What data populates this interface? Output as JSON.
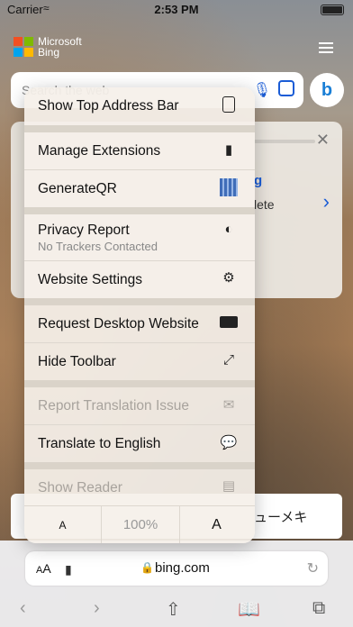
{
  "status": {
    "carrier": "Carrier",
    "time": "2:53 PM"
  },
  "bing": {
    "brand_line1": "Microsoft",
    "brand_line2": "Bing",
    "search_placeholder": "Search the web"
  },
  "card": {
    "title_fragment": "g",
    "subtitle_fragment": "lete"
  },
  "news": {
    "text_fragment": "ューメキ"
  },
  "menu": {
    "show_top_address_bar": "Show Top Address Bar",
    "manage_extensions": "Manage Extensions",
    "generate_qr": "GenerateQR",
    "privacy_report": "Privacy Report",
    "privacy_report_sub": "No Trackers Contacted",
    "website_settings": "Website Settings",
    "request_desktop": "Request Desktop Website",
    "hide_toolbar": "Hide Toolbar",
    "report_translation": "Report Translation Issue",
    "translate_english": "Translate to English",
    "show_reader": "Show Reader",
    "font_small": "A",
    "font_percent": "100%",
    "font_large": "A"
  },
  "addressbar": {
    "aa_label": "AA",
    "url": "bing.com"
  }
}
